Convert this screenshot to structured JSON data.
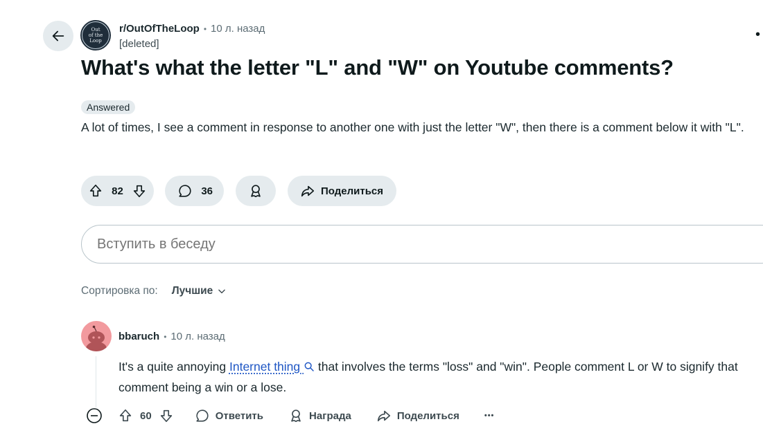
{
  "post": {
    "subreddit": "r/OutOfTheLoop",
    "subreddit_icon_text": [
      "Out",
      "of the",
      "Loop"
    ],
    "separator": "•",
    "time": "10 л. назад",
    "author": "[deleted]",
    "title": "What's what the letter \"L\" and \"W\" on Youtube comments?",
    "flair": "Answered",
    "body": "A lot of times, I see a comment in response to another one with just the letter \"W\", then there is a comment below it with \"L\".",
    "votes": "82",
    "comments": "36",
    "share_label": "Поделиться"
  },
  "join": {
    "placeholder": "Вступить в беседу"
  },
  "sort": {
    "label": "Сортировка по:",
    "value": "Лучшие"
  },
  "comment": {
    "author": "bbaruch",
    "time": "10 л. назад",
    "text_before": "It's a quite annoying ",
    "link_text": "Internet thing",
    "text_after": " that involves the terms \"loss\" and \"win\". People comment L or W to signify that comment being a win or a lose.",
    "votes": "60",
    "reply_label": "Ответить",
    "award_label": "Награда",
    "share_label": "Поделиться",
    "more": "•••"
  },
  "colors": {
    "pill_bg": "#e5ebee",
    "link": "#1e56c4",
    "avatar": "#f29a9e"
  }
}
